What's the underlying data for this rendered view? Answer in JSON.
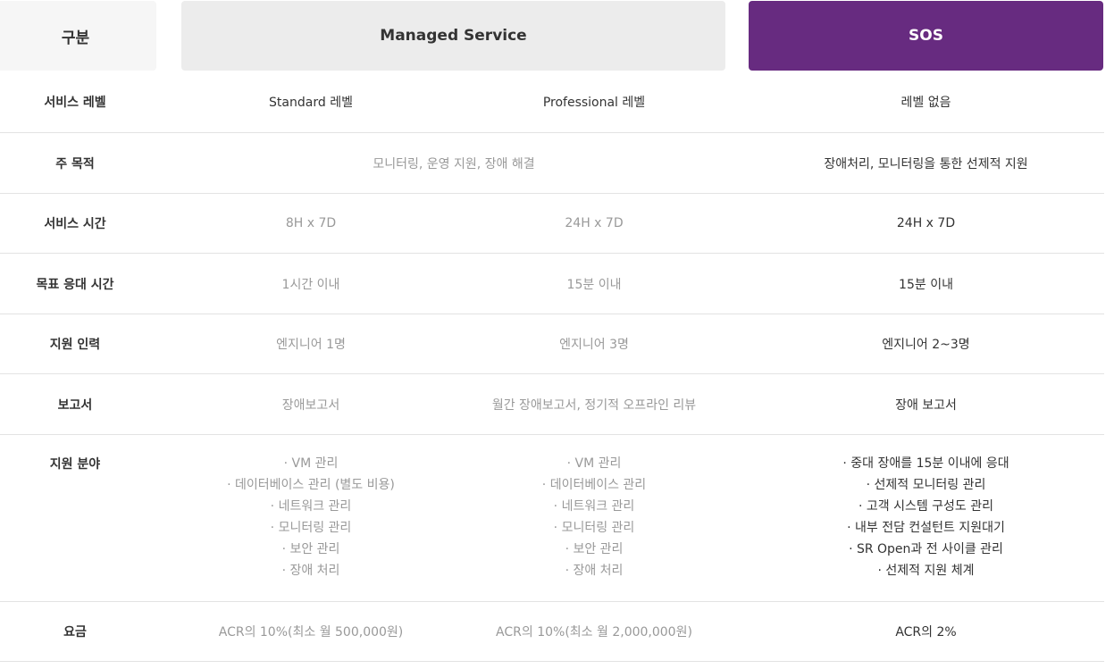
{
  "header": {
    "category": "구분",
    "managed": "Managed Service",
    "sos": "SOS"
  },
  "rows": [
    {
      "label": "서비스 레벨",
      "standard": "Standard 레벨",
      "professional": "Professional 레벨",
      "sos": "레벨 없음"
    },
    {
      "label": "주 목적",
      "managed": "모니터링, 운영 지원, 장애 해결",
      "sos": "장애처리, 모니터링을 통한 선제적 지원"
    },
    {
      "label": "서비스 시간",
      "standard": "8H x 7D",
      "professional": "24H x 7D",
      "sos": "24H x 7D"
    },
    {
      "label": "목표 응대 시간",
      "standard": "1시간 이내",
      "professional": "15분 이내",
      "sos": "15분 이내"
    },
    {
      "label": "지원 인력",
      "standard": "엔지니어 1명",
      "professional": "엔지니어 3명",
      "sos": "엔지니어 2~3명"
    },
    {
      "label": "보고서",
      "standard": "장애보고서",
      "professional": "월간 장애보고서, 정기적 오프라인 리뷰",
      "sos": "장애 보고서"
    },
    {
      "label": "지원 분야",
      "standard": [
        "· VM 관리",
        "· 데이터베이스 관리 (별도 비용)",
        "· 네트워크 관리",
        "· 모니터링 관리",
        "· 보안 관리",
        "· 장애 처리"
      ],
      "professional": [
        "· VM 관리",
        "· 데이터베이스 관리",
        "· 네트워크 관리",
        "· 모니터링 관리",
        "· 보안 관리",
        "· 장애 처리"
      ],
      "sos": [
        "· 중대 장애를 15분 이내에 응대",
        "· 선제적 모니터링 관리",
        "· 고객 시스템 구성도 관리",
        "· 내부 전담 컨설턴트 지원대기",
        "· SR Open과 전 사이클 관리",
        "· 선제적 지원 체계"
      ]
    },
    {
      "label": "요금",
      "standard": "ACR의 10%(최소 월 500,000원)",
      "professional": "ACR의 10%(최소 월 2,000,000원)",
      "sos": "ACR의 2%"
    }
  ],
  "colors": {
    "accent": "#672b80",
    "header_gray": "#ececec",
    "muted_text": "#999999"
  }
}
